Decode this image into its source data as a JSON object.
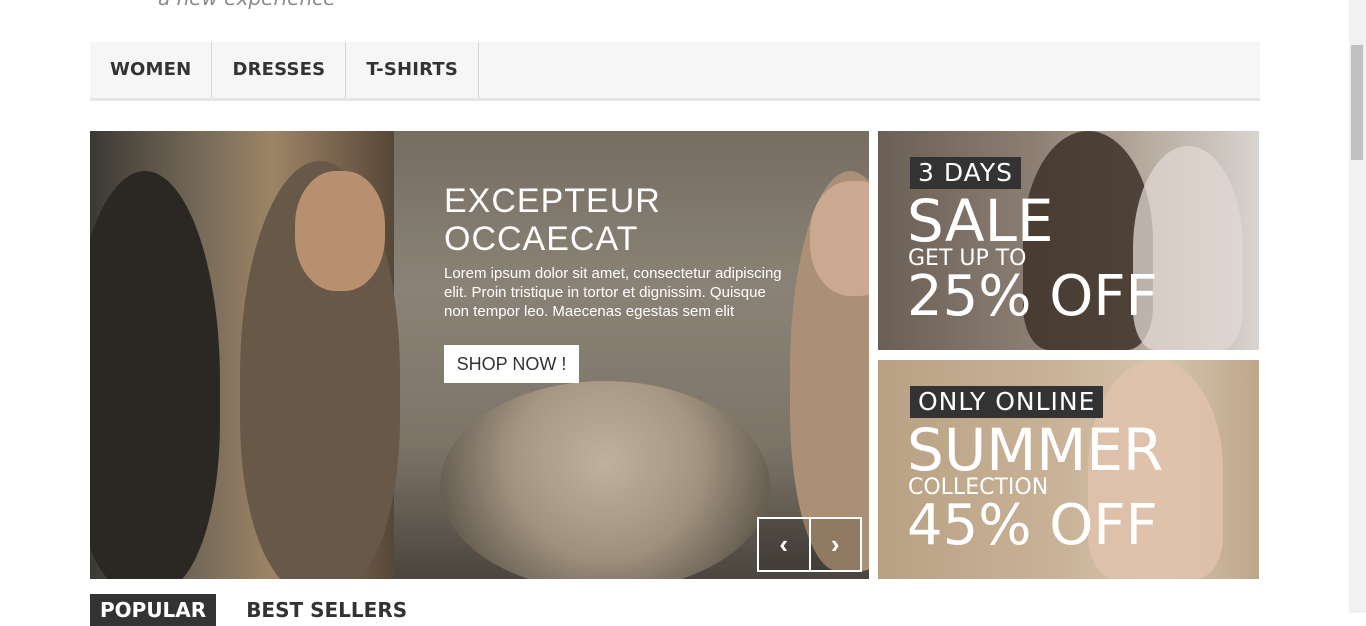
{
  "header": {
    "tagline": "a new experience"
  },
  "nav": {
    "items": [
      {
        "label": "WOMEN"
      },
      {
        "label": "DRESSES"
      },
      {
        "label": "T-SHIRTS"
      }
    ]
  },
  "slider": {
    "title": "EXCEPTEUR OCCAECAT",
    "text": "Lorem ipsum dolor sit amet, consectetur adipiscing elit. Proin tristique in tortor et dignissim. Quisque non tempor leo. Maecenas egestas sem elit",
    "button_label": "SHOP NOW !",
    "prev_icon": "chevron-left-icon",
    "next_icon": "chevron-right-icon"
  },
  "banners": [
    {
      "badge": "3 DAYS",
      "headline": "SALE",
      "subline": "GET UP TO",
      "offer": "25% OFF"
    },
    {
      "badge": "ONLY ONLINE",
      "headline": "SUMMER",
      "subline": "COLLECTION",
      "offer": "45% OFF"
    }
  ],
  "tabs": {
    "popular": "POPULAR",
    "best_sellers": "BEST SELLERS"
  },
  "icons": {
    "prev": "‹",
    "next": "›"
  },
  "colors": {
    "nav_bg": "#f6f6f6",
    "badge_bg": "#333333",
    "text_white": "#ffffff"
  }
}
